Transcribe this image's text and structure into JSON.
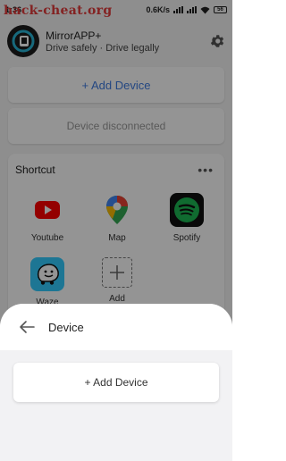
{
  "status_bar": {
    "time": "1:36",
    "speed": "0.6K/s",
    "battery": "56",
    "overlay_watermark": "hack-cheat.org"
  },
  "header": {
    "app_title": "MirrorAPP+",
    "app_subtitle": "Drive safely · Drive legally"
  },
  "main": {
    "add_device_label": "+ Add Device",
    "connection_status": "Device disconnected",
    "shortcut": {
      "title": "Shortcut",
      "more_label": "•••",
      "apps": [
        {
          "label": "Youtube"
        },
        {
          "label": "Map"
        },
        {
          "label": "Spotify"
        },
        {
          "label": "Waze"
        },
        {
          "label": "Add"
        }
      ]
    }
  },
  "sheet": {
    "title": "Device",
    "add_device_label": "+ Add Device"
  },
  "colors": {
    "accent": "#3f7be0",
    "youtube": "#ff0000",
    "spotify": "#1db954",
    "waze": "#33ccff"
  }
}
